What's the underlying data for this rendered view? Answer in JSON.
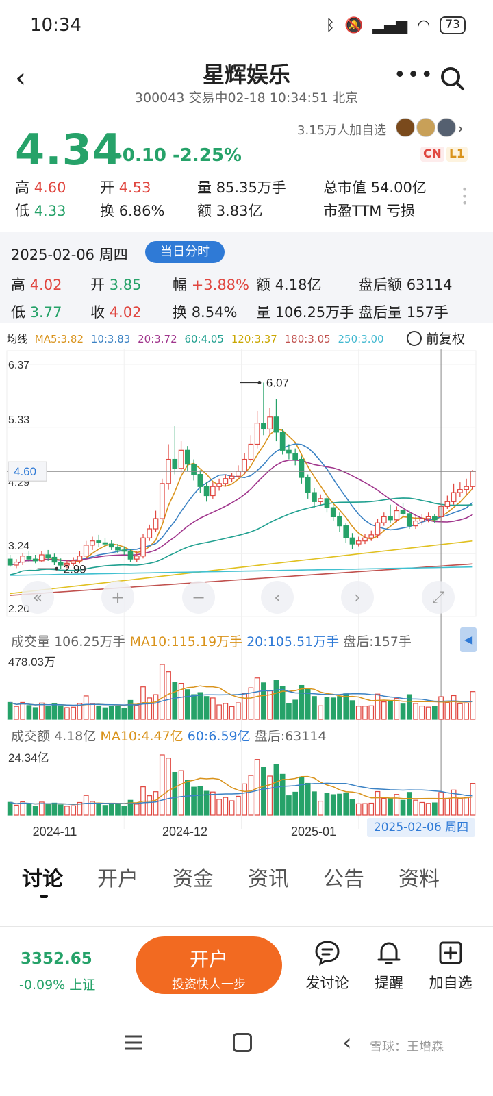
{
  "status_bar": {
    "time": "10:34",
    "battery": "73"
  },
  "header": {
    "title": "星辉娱乐",
    "subtitle": "300043 交易中02-18 10:34:51 北京"
  },
  "quote": {
    "price": "4.34",
    "change": "-0.10 -2.25%",
    "watchers": "3.15万人加自选",
    "badge_cn": "CN",
    "badge_l1": "L1",
    "high_label": "高",
    "high": "4.60",
    "open_label": "开",
    "open": "4.53",
    "volume_label": "量",
    "volume": "85.35万手",
    "mcap_label": "总市值",
    "mcap": "54.00亿",
    "low_label": "低",
    "low": "4.33",
    "turnover_label": "换",
    "turnover": "6.86%",
    "amount_label": "额",
    "amount": "3.83亿",
    "pe_label": "市盈TTM",
    "pe": "亏损"
  },
  "day_detail": {
    "date": "2025-02-06 周四",
    "intraday_button": "当日分时",
    "high_label": "高",
    "high": "4.02",
    "open_label": "开",
    "open": "3.85",
    "amp_label": "幅",
    "amp": "+3.88%",
    "amount_label": "额",
    "amount": "4.18亿",
    "ah_amount_label": "盘后额",
    "ah_amount": "63114",
    "low_label": "低",
    "low": "3.77",
    "close_label": "收",
    "close": "4.02",
    "turnover_label": "换",
    "turnover": "8.54%",
    "volume_label": "量",
    "volume": "106.25万手",
    "ah_volume_label": "盘后量",
    "ah_volume": "157手"
  },
  "ma_legend": {
    "label": "均线",
    "ma5": "MA5:3.82",
    "ma10": "10:3.83",
    "ma20": "20:3.72",
    "ma60": "60:4.05",
    "ma120": "120:3.37",
    "ma180": "180:3.05",
    "ma250": "250:3.00",
    "restore": "前复权"
  },
  "volume_legend": {
    "label": "成交量",
    "value": "106.25万手",
    "ma10": "MA10:115.19万手",
    "ma20": "20:105.51万手",
    "after": "盘后:157手",
    "max": "478.03万"
  },
  "amount_legend": {
    "label": "成交额",
    "value": "4.18亿",
    "ma10": "MA10:4.47亿",
    "ma60": "60:6.59亿",
    "after": "盘后:63114",
    "max": "24.34亿"
  },
  "selected_date_tag": "2025-02-06 周四",
  "tabs": [
    "讨论",
    "开户",
    "资金",
    "资讯",
    "公告",
    "资料"
  ],
  "bottom_bar": {
    "index_value": "3352.65",
    "index_change": "-0.09% 上证",
    "open_account": "开户",
    "open_account_sub": "投资快人一步",
    "post": "发讨论",
    "alert": "提醒",
    "add_watch": "加自选"
  },
  "watermark": "雪球：王增森",
  "colors": {
    "up": "#e0463f",
    "down": "#26a269",
    "accent": "#2f7ad6",
    "ma5": "#d9931c",
    "ma10": "#3b82c4",
    "ma20": "#a0358c",
    "ma60": "#20a090",
    "ma120": "#e0c020",
    "ma180": "#c0504d",
    "ma250": "#40c0d0"
  },
  "chart_data": {
    "type": "candlestick",
    "y_ticks": [
      "6.37",
      "5.33",
      "4.29",
      "3.24",
      "2.20"
    ],
    "y_range": [
      2.2,
      6.37
    ],
    "crosshair_price": "4.60",
    "x_labels": [
      "2024-11",
      "2024-12",
      "2025-01"
    ],
    "annotations": [
      {
        "label": "6.07",
        "value": 6.07
      },
      {
        "label": "2.99",
        "value": 2.99
      }
    ],
    "candles": [
      [
        3.15,
        3.05,
        3.22,
        3.02
      ],
      [
        3.05,
        3.1,
        3.15,
        3.0
      ],
      [
        3.1,
        3.2,
        3.25,
        3.05
      ],
      [
        3.2,
        3.15,
        3.28,
        3.1
      ],
      [
        3.15,
        3.12,
        3.22,
        3.08
      ],
      [
        3.12,
        3.22,
        3.28,
        3.1
      ],
      [
        3.22,
        3.18,
        3.3,
        3.12
      ],
      [
        3.18,
        3.1,
        3.24,
        3.05
      ],
      [
        3.1,
        3.05,
        3.16,
        2.99
      ],
      [
        3.05,
        3.08,
        3.14,
        3.0
      ],
      [
        3.08,
        3.12,
        3.18,
        3.04
      ],
      [
        3.12,
        3.2,
        3.28,
        3.08
      ],
      [
        3.2,
        3.38,
        3.45,
        3.16
      ],
      [
        3.38,
        3.45,
        3.52,
        3.3
      ],
      [
        3.45,
        3.42,
        3.55,
        3.35
      ],
      [
        3.42,
        3.4,
        3.5,
        3.35
      ],
      [
        3.4,
        3.35,
        3.46,
        3.3
      ],
      [
        3.35,
        3.3,
        3.4,
        3.25
      ],
      [
        3.3,
        3.28,
        3.36,
        3.22
      ],
      [
        3.28,
        3.15,
        3.32,
        3.1
      ],
      [
        3.15,
        3.2,
        3.28,
        3.1
      ],
      [
        3.2,
        3.5,
        3.56,
        3.16
      ],
      [
        3.5,
        3.65,
        3.72,
        3.45
      ],
      [
        3.65,
        3.82,
        3.95,
        3.6
      ],
      [
        3.82,
        4.4,
        4.48,
        3.78
      ],
      [
        4.4,
        4.8,
        5.05,
        4.3
      ],
      [
        4.8,
        4.65,
        5.35,
        4.55
      ],
      [
        4.65,
        4.95,
        5.1,
        4.58
      ],
      [
        4.95,
        4.72,
        5.02,
        4.6
      ],
      [
        4.72,
        4.55,
        4.8,
        4.45
      ],
      [
        4.55,
        4.35,
        4.62,
        4.25
      ],
      [
        4.35,
        4.2,
        4.42,
        4.1
      ],
      [
        4.2,
        4.35,
        4.42,
        4.15
      ],
      [
        4.35,
        4.4,
        4.48,
        4.28
      ],
      [
        4.4,
        4.48,
        4.55,
        4.35
      ],
      [
        4.48,
        4.52,
        4.58,
        4.42
      ],
      [
        4.52,
        4.6,
        4.7,
        4.48
      ],
      [
        4.6,
        4.8,
        4.9,
        4.55
      ],
      [
        4.8,
        5.05,
        5.2,
        4.75
      ],
      [
        5.05,
        5.4,
        5.6,
        4.98
      ],
      [
        5.4,
        5.3,
        6.07,
        5.2
      ],
      [
        5.3,
        5.5,
        5.65,
        5.22
      ],
      [
        5.5,
        5.25,
        5.8,
        5.1
      ],
      [
        5.25,
        4.95,
        5.3,
        4.88
      ],
      [
        4.95,
        4.9,
        5.05,
        4.8
      ],
      [
        4.9,
        4.8,
        4.98,
        4.7
      ],
      [
        4.8,
        4.5,
        4.85,
        4.4
      ],
      [
        4.5,
        4.25,
        4.55,
        4.15
      ],
      [
        4.25,
        4.1,
        4.32,
        4.0
      ],
      [
        4.1,
        4.15,
        4.22,
        4.05
      ],
      [
        4.15,
        4.0,
        4.2,
        3.92
      ],
      [
        4.0,
        3.85,
        4.05,
        3.78
      ],
      [
        3.85,
        3.7,
        3.92,
        3.6
      ],
      [
        3.7,
        3.5,
        3.75,
        3.42
      ],
      [
        3.5,
        3.4,
        3.58,
        3.32
      ],
      [
        3.4,
        3.45,
        3.52,
        3.36
      ],
      [
        3.45,
        3.5,
        3.56,
        3.4
      ],
      [
        3.5,
        3.55,
        3.62,
        3.45
      ],
      [
        3.55,
        3.75,
        3.82,
        3.5
      ],
      [
        3.75,
        3.85,
        3.92,
        3.7
      ],
      [
        3.85,
        3.8,
        4.05,
        3.74
      ],
      [
        3.8,
        3.95,
        4.02,
        3.76
      ],
      [
        3.95,
        3.9,
        4.08,
        3.85
      ],
      [
        3.9,
        3.7,
        3.95,
        3.65
      ],
      [
        3.7,
        3.78,
        3.85,
        3.65
      ],
      [
        3.78,
        3.82,
        3.9,
        3.72
      ],
      [
        3.82,
        3.85,
        3.92,
        3.76
      ],
      [
        3.85,
        3.8,
        3.9,
        3.75
      ],
      [
        3.85,
        4.02,
        4.05,
        3.77
      ],
      [
        4.02,
        4.1,
        4.2,
        3.98
      ],
      [
        4.1,
        4.25,
        4.4,
        4.05
      ],
      [
        4.25,
        4.3,
        4.42,
        4.18
      ],
      [
        4.3,
        4.35,
        4.48,
        4.22
      ],
      [
        4.35,
        4.6,
        4.62,
        4.3
      ]
    ]
  }
}
